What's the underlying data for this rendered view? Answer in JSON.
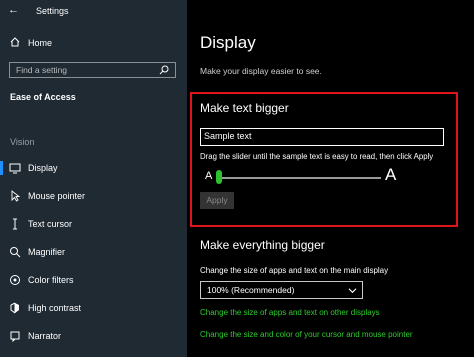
{
  "window": {
    "app_title": "Settings"
  },
  "sidebar": {
    "home_label": "Home",
    "search_placeholder": "Find a setting",
    "section_title": "Ease of Access",
    "group_label": "Vision",
    "items": [
      {
        "label": "Display",
        "icon": "display-icon",
        "active": true
      },
      {
        "label": "Mouse pointer",
        "icon": "mouse-pointer-icon",
        "active": false
      },
      {
        "label": "Text cursor",
        "icon": "text-cursor-icon",
        "active": false
      },
      {
        "label": "Magnifier",
        "icon": "magnifier-icon",
        "active": false
      },
      {
        "label": "Color filters",
        "icon": "color-filters-icon",
        "active": false
      },
      {
        "label": "High contrast",
        "icon": "high-contrast-icon",
        "active": false
      },
      {
        "label": "Narrator",
        "icon": "narrator-icon",
        "active": false
      }
    ]
  },
  "main": {
    "title": "Display",
    "subtitle": "Make your display easier to see.",
    "text_bigger": {
      "title": "Make text bigger",
      "sample_text": "Sample text",
      "instruction": "Drag the slider until the sample text is easy to read, then click Apply",
      "small_a": "A",
      "large_a": "A",
      "apply_label": "Apply",
      "slider_value_percent": 0
    },
    "everything_bigger": {
      "title": "Make everything bigger",
      "description": "Change the size of apps and text on the main display",
      "dropdown_value": "100% (Recommended)",
      "link_other_displays": "Change the size of apps and text on other displays",
      "link_cursor": "Change the size and color of your cursor and mouse pointer"
    }
  },
  "colors": {
    "sidebar_bg": "#1f2a33",
    "accent_blue": "#1e90ff",
    "slider_green": "#2ec12e",
    "link_green": "#2ecc2e",
    "highlight_red": "#e0141c"
  }
}
